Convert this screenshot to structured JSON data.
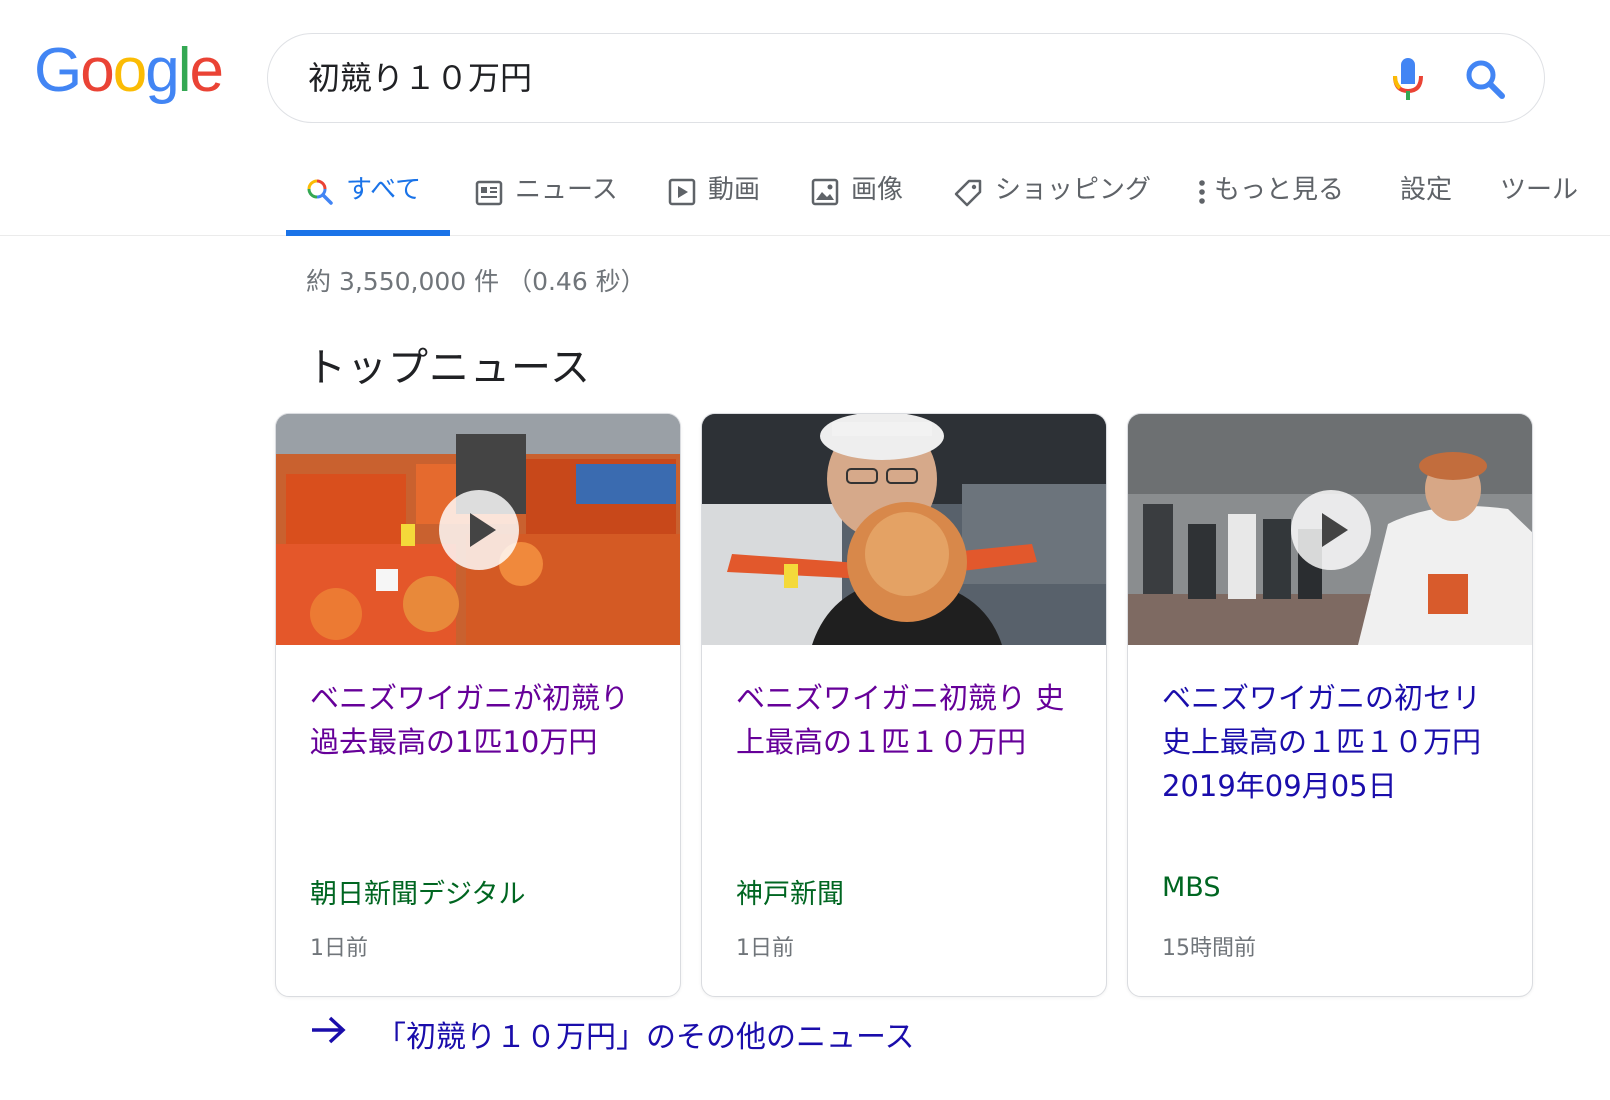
{
  "logo": {
    "text": "Google",
    "letters": [
      "G",
      "o",
      "o",
      "g",
      "l",
      "e"
    ],
    "colors": [
      "#4285f4",
      "#ea4335",
      "#fbbc05",
      "#4285f4",
      "#34a853",
      "#ea4335"
    ]
  },
  "search": {
    "query": "初競り１０万円"
  },
  "tabs": [
    {
      "label": "すべて",
      "icon": "search-icon",
      "active": true
    },
    {
      "label": "ニュース",
      "icon": "newspaper-icon"
    },
    {
      "label": "動画",
      "icon": "video-icon"
    },
    {
      "label": "画像",
      "icon": "image-icon"
    },
    {
      "label": "ショッピング",
      "icon": "tag-icon"
    },
    {
      "label": "もっと見る",
      "icon": "more-vertical-icon"
    },
    {
      "label": "設定"
    },
    {
      "label": "ツール"
    }
  ],
  "stats": "約 3,550,000 件 （0.46 秒）",
  "section_title": "トップニュース",
  "cards": [
    {
      "title": "ベニズワイガニが初競り 過去最高の1匹10万円",
      "source": "朝日新聞デジタル",
      "time": "1日前",
      "has_video": true
    },
    {
      "title": "ベニズワイガニ初競り 史上最高の１匹１０万円",
      "source": "神戸新聞",
      "time": "1日前",
      "has_video": false
    },
    {
      "title": "ベニズワイガニの初セリ 史上最高の１匹１０万円 2019年09月05日",
      "source": "MBS",
      "time": "15時間前",
      "has_video": true
    }
  ],
  "more_news": "「初競り１０万円」のその他のニュース",
  "colors": {
    "accent": "#1a73e8",
    "visited_link": "#660099",
    "link": "#1a0dab",
    "source": "#006621"
  }
}
